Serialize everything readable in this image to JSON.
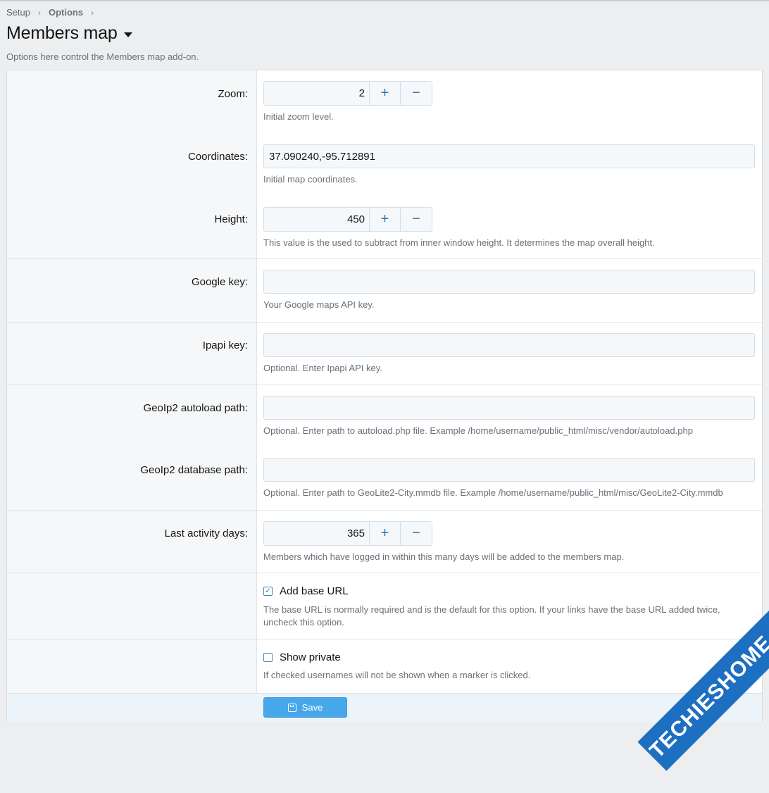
{
  "breadcrumb": {
    "items": [
      "Setup",
      "Options"
    ]
  },
  "page": {
    "title": "Members map",
    "description": "Options here control the Members map add-on."
  },
  "options": {
    "zoom": {
      "label": "Zoom:",
      "value": "2",
      "hint": "Initial zoom level."
    },
    "coordinates": {
      "label": "Coordinates:",
      "value": "37.090240,-95.712891",
      "hint": "Initial map coordinates."
    },
    "height": {
      "label": "Height:",
      "value": "450",
      "hint": "This value is the used to subtract from inner window height. It determines the map overall height."
    },
    "google_key": {
      "label": "Google key:",
      "value": "",
      "hint": "Your Google maps API key."
    },
    "ipapi_key": {
      "label": "Ipapi key:",
      "value": "",
      "hint": "Optional. Enter Ipapi API key."
    },
    "geoip2_autoload": {
      "label": "GeoIp2 autoload path:",
      "value": "",
      "hint": "Optional. Enter path to autoload.php file. Example /home/username/public_html/misc/vendor/autoload.php"
    },
    "geoip2_database": {
      "label": "GeoIp2 database path:",
      "value": "",
      "hint": "Optional. Enter path to GeoLite2-City.mmdb file. Example /home/username/public_html/misc/GeoLite2-City.mmdb"
    },
    "last_activity": {
      "label": "Last activity days:",
      "value": "365",
      "hint": "Members which have logged in within this many days will be added to the members map."
    },
    "add_base_url": {
      "label": "Add base URL",
      "checked": true,
      "hint": "The base URL is normally required and is the default for this option. If your links have the base URL added twice, uncheck this option."
    },
    "show_private": {
      "label": "Show private",
      "checked": false,
      "hint": "If checked usernames will not be shown when a marker is clicked."
    }
  },
  "stepper": {
    "plus": "+",
    "minus": "−"
  },
  "checkmark": "✓",
  "footer": {
    "save_label": "Save"
  },
  "watermark": {
    "text": "TECHIESHOME.COM"
  },
  "colors": {
    "accent": "#2577b1",
    "save_button": "#47a7eb",
    "watermark": "#1d6fc1"
  }
}
